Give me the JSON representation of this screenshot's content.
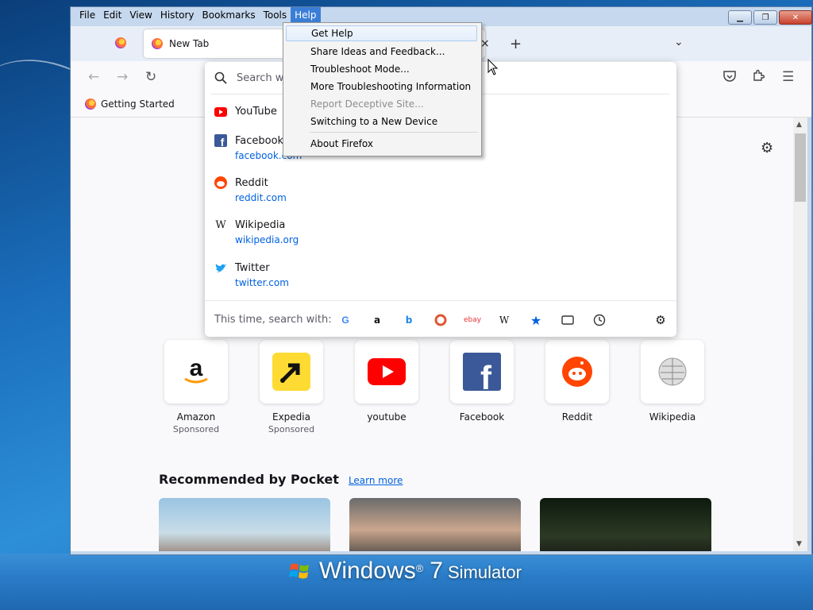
{
  "desktop": {
    "brand_windows": "Windows",
    "brand_reg": "®",
    "brand_version": "7",
    "brand_sim": "Simulator"
  },
  "menubar": {
    "items": [
      "File",
      "Edit",
      "View",
      "History",
      "Bookmarks",
      "Tools",
      "Help"
    ],
    "active": "Help"
  },
  "tabs": {
    "active_title": "New Tab",
    "close_glyph": "×",
    "new_tab_glyph": "+",
    "list_glyph": "⌄"
  },
  "bookmarks": {
    "items": [
      {
        "label": "Getting Started"
      }
    ]
  },
  "urlbar": {
    "placeholder": "Search wi",
    "suggestions": [
      {
        "title": "YouTube",
        "url": ""
      },
      {
        "title": "Facebook",
        "url": "facebook.com"
      },
      {
        "title": "Reddit",
        "url": "reddit.com"
      },
      {
        "title": "Wikipedia",
        "url": "wikipedia.org"
      },
      {
        "title": "Twitter",
        "url": "twitter.com"
      }
    ],
    "footer_label": "This time, search with:",
    "engines": [
      "google-icon",
      "amazon-icon",
      "bing-icon",
      "duckduckgo-icon",
      "ebay-icon",
      "wikipedia-icon",
      "bookmarks-star-icon",
      "tabs-icon",
      "history-clock-icon",
      "settings-gear-icon"
    ]
  },
  "help_menu": {
    "items": [
      {
        "label": "Get Help",
        "highlighted": true,
        "disabled": false
      },
      {
        "label": "Share Ideas and Feedback...",
        "highlighted": false,
        "disabled": false
      },
      {
        "label": "Troubleshoot Mode...",
        "highlighted": false,
        "disabled": false
      },
      {
        "label": "More Troubleshooting Information",
        "highlighted": false,
        "disabled": false
      },
      {
        "label": "Report Deceptive Site...",
        "highlighted": false,
        "disabled": true
      },
      {
        "label": "Switching to a New Device",
        "highlighted": false,
        "disabled": false
      },
      {
        "label": "About Firefox",
        "highlighted": false,
        "disabled": false
      }
    ]
  },
  "top_sites": [
    {
      "name": "Amazon",
      "sponsored": "Sponsored"
    },
    {
      "name": "Expedia",
      "sponsored": "Sponsored"
    },
    {
      "name": "youtube",
      "sponsored": ""
    },
    {
      "name": "Facebook",
      "sponsored": ""
    },
    {
      "name": "Reddit",
      "sponsored": ""
    },
    {
      "name": "Wikipedia",
      "sponsored": ""
    }
  ],
  "pocket": {
    "title": "Recommended by Pocket",
    "learn_more": "Learn more"
  },
  "colors": {
    "accent_menu": "#3b7ed6",
    "link": "#0061e0"
  }
}
